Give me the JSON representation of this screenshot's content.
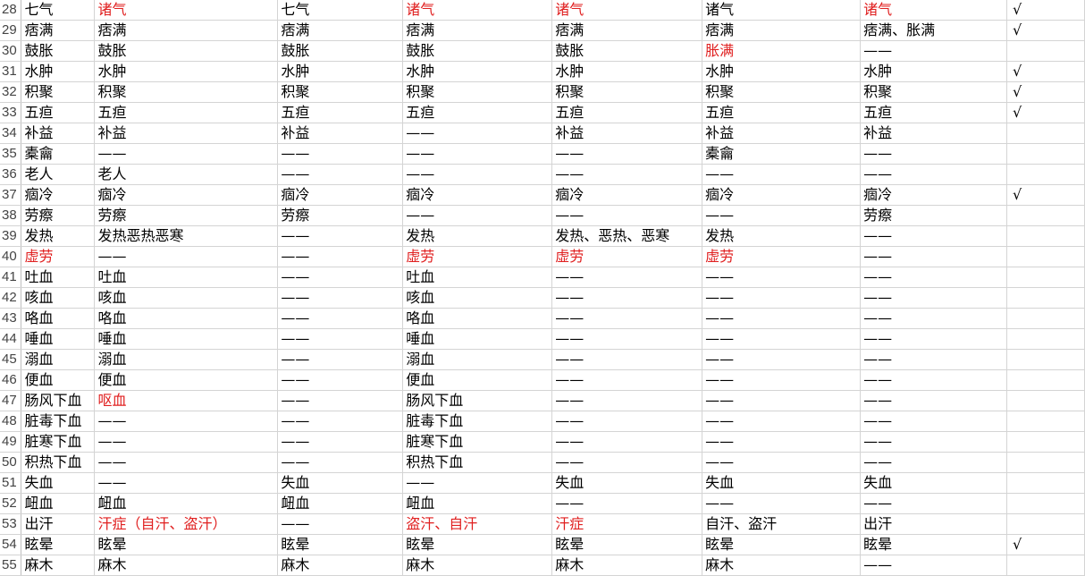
{
  "sheet": {
    "red_color": "#e02020",
    "rows": [
      {
        "num": "28",
        "cells": [
          "七气",
          "诸气",
          "七气",
          "诸气",
          "诸气",
          "诸气",
          "诸气",
          "√"
        ],
        "red": [
          1,
          3,
          4,
          6
        ]
      },
      {
        "num": "29",
        "cells": [
          "痞满",
          "痞满",
          "痞满",
          "痞满",
          "痞满",
          "痞满",
          "痞满、胀满",
          "√"
        ],
        "red": []
      },
      {
        "num": "30",
        "cells": [
          "鼓胀",
          "鼓胀",
          "鼓胀",
          "鼓胀",
          "鼓胀",
          "胀满",
          "——",
          ""
        ],
        "red": [
          5
        ]
      },
      {
        "num": "31",
        "cells": [
          "水肿",
          "水肿",
          "水肿",
          "水肿",
          "水肿",
          "水肿",
          "水肿",
          "√"
        ],
        "red": []
      },
      {
        "num": "32",
        "cells": [
          "积聚",
          "积聚",
          "积聚",
          "积聚",
          "积聚",
          "积聚",
          "积聚",
          "√"
        ],
        "red": []
      },
      {
        "num": "33",
        "cells": [
          "五疸",
          "五疸",
          "五疸",
          "五疸",
          "五疸",
          "五疸",
          "五疸",
          "√"
        ],
        "red": []
      },
      {
        "num": "34",
        "cells": [
          "补益",
          "补益",
          "补益",
          "——",
          "补益",
          "补益",
          "补益",
          ""
        ],
        "red": []
      },
      {
        "num": "35",
        "cells": [
          "橐龠",
          "——",
          "——",
          "——",
          "——",
          "橐龠",
          "——",
          ""
        ],
        "red": []
      },
      {
        "num": "36",
        "cells": [
          "老人",
          "老人",
          "——",
          "——",
          "——",
          "——",
          "——",
          ""
        ],
        "red": []
      },
      {
        "num": "37",
        "cells": [
          "痼冷",
          "痼冷",
          "痼冷",
          "痼冷",
          "痼冷",
          "痼冷",
          "痼冷",
          "√"
        ],
        "red": []
      },
      {
        "num": "38",
        "cells": [
          "劳瘵",
          "劳瘵",
          "劳瘵",
          "——",
          "——",
          "——",
          "劳瘵",
          ""
        ],
        "red": []
      },
      {
        "num": "39",
        "cells": [
          "发热",
          "发热恶热恶寒",
          "——",
          "发热",
          "发热、恶热、恶寒",
          "发热",
          "——",
          ""
        ],
        "red": []
      },
      {
        "num": "40",
        "cells": [
          "虚劳",
          "——",
          "——",
          "虚劳",
          "虚劳",
          "虚劳",
          "——",
          ""
        ],
        "red": [
          0,
          3,
          4,
          5
        ]
      },
      {
        "num": "41",
        "cells": [
          "吐血",
          "吐血",
          "——",
          "吐血",
          "——",
          "——",
          "——",
          ""
        ],
        "red": []
      },
      {
        "num": "42",
        "cells": [
          "咳血",
          "咳血",
          "——",
          "咳血",
          "——",
          "——",
          "——",
          ""
        ],
        "red": []
      },
      {
        "num": "43",
        "cells": [
          "咯血",
          "咯血",
          "——",
          "咯血",
          "——",
          "——",
          "——",
          ""
        ],
        "red": []
      },
      {
        "num": "44",
        "cells": [
          "唾血",
          "唾血",
          "——",
          "唾血",
          "——",
          "——",
          "——",
          ""
        ],
        "red": []
      },
      {
        "num": "45",
        "cells": [
          "溺血",
          "溺血",
          "——",
          "溺血",
          "——",
          "——",
          "——",
          ""
        ],
        "red": []
      },
      {
        "num": "46",
        "cells": [
          "便血",
          "便血",
          "——",
          "便血",
          "——",
          "——",
          "——",
          ""
        ],
        "red": []
      },
      {
        "num": "47",
        "cells": [
          "肠风下血",
          "呕血",
          "——",
          "肠风下血",
          "——",
          "——",
          "——",
          ""
        ],
        "red": [
          1
        ]
      },
      {
        "num": "48",
        "cells": [
          "脏毒下血",
          "——",
          "——",
          "脏毒下血",
          "——",
          "——",
          "——",
          ""
        ],
        "red": []
      },
      {
        "num": "49",
        "cells": [
          "脏寒下血",
          "——",
          "——",
          "脏寒下血",
          "——",
          "——",
          "——",
          ""
        ],
        "red": []
      },
      {
        "num": "50",
        "cells": [
          "积热下血",
          "——",
          "——",
          "积热下血",
          "——",
          "——",
          "——",
          ""
        ],
        "red": []
      },
      {
        "num": "51",
        "cells": [
          "失血",
          "——",
          "失血",
          "——",
          "失血",
          "失血",
          "失血",
          ""
        ],
        "red": []
      },
      {
        "num": "52",
        "cells": [
          "衄血",
          "衄血",
          "衄血",
          "衄血",
          "——",
          "——",
          "——",
          ""
        ],
        "red": []
      },
      {
        "num": "53",
        "cells": [
          "出汗",
          "汗症（自汗、盗汗）",
          "——",
          "盗汗、自汗",
          "汗症",
          "自汗、盗汗",
          "出汗",
          ""
        ],
        "red": [
          1,
          3,
          4
        ]
      },
      {
        "num": "54",
        "cells": [
          "眩晕",
          "眩晕",
          "眩晕",
          "眩晕",
          "眩晕",
          "眩晕",
          "眩晕",
          "√"
        ],
        "red": []
      },
      {
        "num": "55",
        "cells": [
          "麻木",
          "麻木",
          "麻木",
          "麻木",
          "麻木",
          "麻木",
          "——",
          ""
        ],
        "red": []
      }
    ]
  }
}
